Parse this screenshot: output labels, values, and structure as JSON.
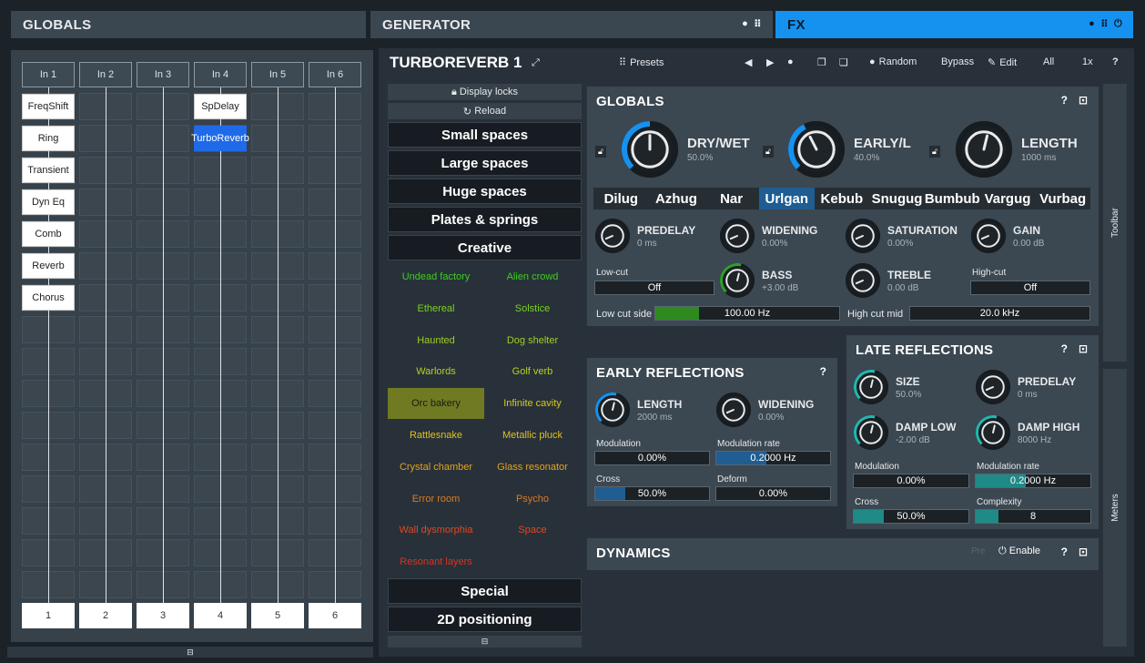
{
  "tabs": {
    "globals": "GLOBALS",
    "generator": "GENERATOR",
    "fx": "FX"
  },
  "routing": {
    "inputs": [
      "In 1",
      "In 2",
      "In 3",
      "In 4",
      "In 5",
      "In 6"
    ],
    "outputs": [
      "1",
      "2",
      "3",
      "4",
      "5",
      "6"
    ],
    "nodes_col1": [
      "FreqShift",
      "Ring",
      "Transient",
      "Dyn Eq",
      "Comb",
      "Reverb",
      "Chorus"
    ],
    "nodes_col4": [
      "SpDelay",
      "TurboReverb"
    ]
  },
  "plugin": {
    "title": "TURBOREVERB 1",
    "presets_label": "Presets",
    "random_label": "Random",
    "bypass_label": "Bypass",
    "edit_label": "Edit",
    "all_label": "All",
    "zoom_label": "1x",
    "help_label": "?"
  },
  "presetbrowser": {
    "display_locks": "Display locks",
    "reload": "Reload",
    "categories": [
      "Small spaces",
      "Large spaces",
      "Huge spaces",
      "Plates & springs",
      "Creative"
    ],
    "bottom_categories": [
      "Special",
      "2D positioning"
    ],
    "presets": [
      {
        "name": "Undead factory",
        "color": "#3ccf20"
      },
      {
        "name": "Alien crowd",
        "color": "#3ccf20"
      },
      {
        "name": "Ethereal",
        "color": "#7ccf20"
      },
      {
        "name": "Solstice",
        "color": "#7ccf20"
      },
      {
        "name": "Haunted",
        "color": "#9fcf20"
      },
      {
        "name": "Dog shelter",
        "color": "#9fcf20"
      },
      {
        "name": "Warlords",
        "color": "#b8cf20"
      },
      {
        "name": "Golf verb",
        "color": "#b8cf20"
      },
      {
        "name": "Orc bakery",
        "color": "#1a1a1a"
      },
      {
        "name": "Infinite cavity",
        "color": "#d8c820"
      },
      {
        "name": "Rattlesnake",
        "color": "#e0c020"
      },
      {
        "name": "Metallic pluck",
        "color": "#e0c020"
      },
      {
        "name": "Crystal chamber",
        "color": "#e6a020"
      },
      {
        "name": "Glass resonator",
        "color": "#e6a020"
      },
      {
        "name": "Error room",
        "color": "#e07820"
      },
      {
        "name": "Psycho",
        "color": "#e07820"
      },
      {
        "name": "Wall dysmorphia",
        "color": "#e04820"
      },
      {
        "name": "Space",
        "color": "#e04820"
      },
      {
        "name": "Resonant layers",
        "color": "#e03020"
      }
    ]
  },
  "globals_section": {
    "title": "GLOBALS",
    "drywet": {
      "name": "DRY/WET",
      "value": "50.0%",
      "level": 0.5
    },
    "early": {
      "name": "EARLY/L",
      "value": "40.0%",
      "level": 0.4
    },
    "length": {
      "name": "LENGTH",
      "value": "1000 ms",
      "level": 0.55
    },
    "algorithms": [
      "Dilug",
      "Azhug",
      "Nar",
      "Urlgan",
      "Kebub",
      "Snugug",
      "Bumbub",
      "Vargug",
      "Vurbag"
    ],
    "predelay": {
      "name": "PREDELAY",
      "value": "0 ms"
    },
    "widening": {
      "name": "WIDENING",
      "value": "0.00%"
    },
    "saturation": {
      "name": "SATURATION",
      "value": "0.00%"
    },
    "gain": {
      "name": "GAIN",
      "value": "0.00 dB"
    },
    "bass": {
      "name": "BASS",
      "value": "+3.00 dB"
    },
    "treble": {
      "name": "TREBLE",
      "value": "0.00 dB"
    },
    "lowcut_label": "Low-cut",
    "lowcut_value": "Off",
    "highcut_label": "High-cut",
    "highcut_value": "Off",
    "lowcutside_label": "Low cut side",
    "lowcutside_value": "100.00 Hz",
    "highcutmid_label": "High cut mid",
    "highcutmid_value": "20.0 kHz"
  },
  "early_section": {
    "title": "EARLY REFLECTIONS",
    "length": {
      "name": "LENGTH",
      "value": "2000 ms"
    },
    "widening": {
      "name": "WIDENING",
      "value": "0.00%"
    },
    "modulation_label": "Modulation",
    "modulation_value": "0.00%",
    "modrate_label": "Modulation rate",
    "modrate_value": "0.2000 Hz",
    "cross_label": "Cross",
    "cross_value": "50.0%",
    "deform_label": "Deform",
    "deform_value": "0.00%"
  },
  "late_section": {
    "title": "LATE REFLECTIONS",
    "size": {
      "name": "SIZE",
      "value": "50.0%"
    },
    "predelay": {
      "name": "PREDELAY",
      "value": "0 ms"
    },
    "damplow": {
      "name": "DAMP LOW",
      "value": "-2.00 dB"
    },
    "damphigh": {
      "name": "DAMP HIGH",
      "value": "8000 Hz"
    },
    "modulation_label": "Modulation",
    "modulation_value": "0.00%",
    "modrate_label": "Modulation rate",
    "modrate_value": "0.2000 Hz",
    "cross_label": "Cross",
    "cross_value": "50.0%",
    "complexity_label": "Complexity",
    "complexity_value": "8"
  },
  "dynamics_section": {
    "title": "DYNAMICS",
    "pre_label": "Pre",
    "enable_label": "Enable"
  },
  "side": {
    "toolbar": "Toolbar",
    "meters": "Meters"
  },
  "colors": {
    "accent": "#1592f0",
    "selected_algo": "#1f5d92",
    "selected_preset": "#6f7a22",
    "lowcut_fill": "#2e8a1e",
    "teal_fill": "#1f8a86",
    "blue_fill": "#1f5d92"
  }
}
